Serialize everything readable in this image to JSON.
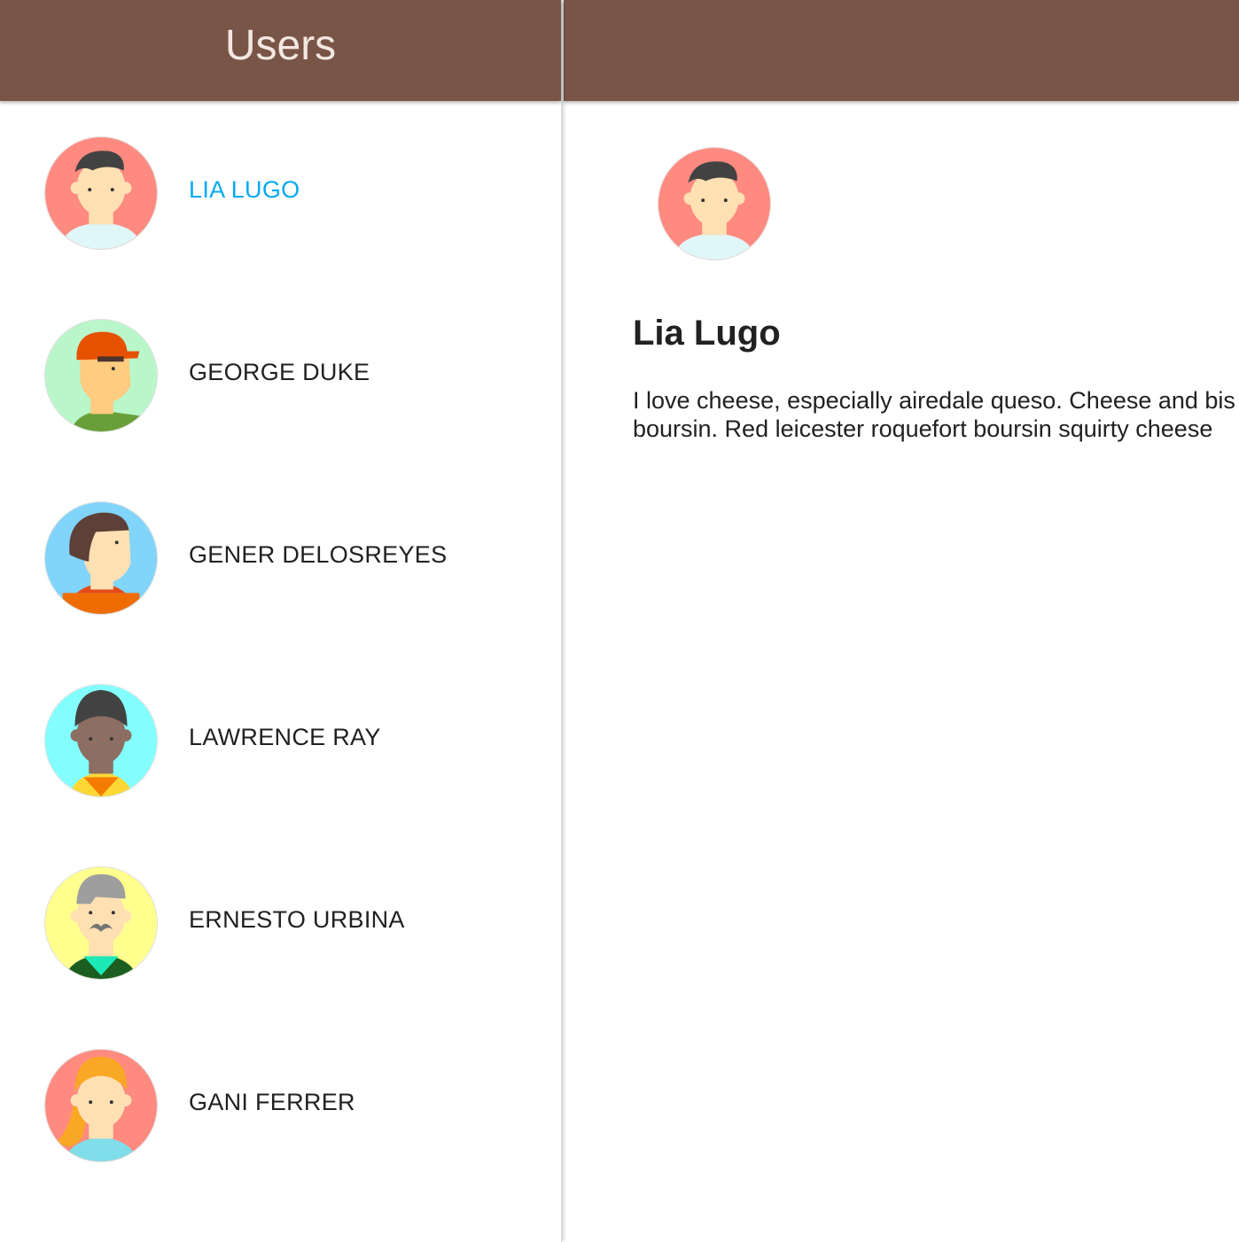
{
  "header": {
    "title": "Users"
  },
  "colors": {
    "toolbar": "#795548",
    "accent": "#03a9f4",
    "text": "#212121"
  },
  "users": [
    {
      "name": "LIA LUGO",
      "avatar": "avatar-woman-red-bg-icon",
      "selected": true
    },
    {
      "name": "GEORGE DUKE",
      "avatar": "avatar-man-orange-cap-icon",
      "selected": false
    },
    {
      "name": "GENER DELOSREYES",
      "avatar": "avatar-man-blue-bg-icon",
      "selected": false
    },
    {
      "name": "LAWRENCE RAY",
      "avatar": "avatar-man-cyan-bg-icon",
      "selected": false
    },
    {
      "name": "ERNESTO URBINA",
      "avatar": "avatar-old-man-mustache-icon",
      "selected": false
    },
    {
      "name": "GANI FERRER",
      "avatar": "avatar-woman-blonde-icon",
      "selected": false
    }
  ],
  "detail": {
    "name": "Lia Lugo",
    "bio_line1": "I love cheese, especially airedale queso. Cheese and bis",
    "bio_line2": "boursin. Red leicester roquefort boursin squirty cheese"
  }
}
